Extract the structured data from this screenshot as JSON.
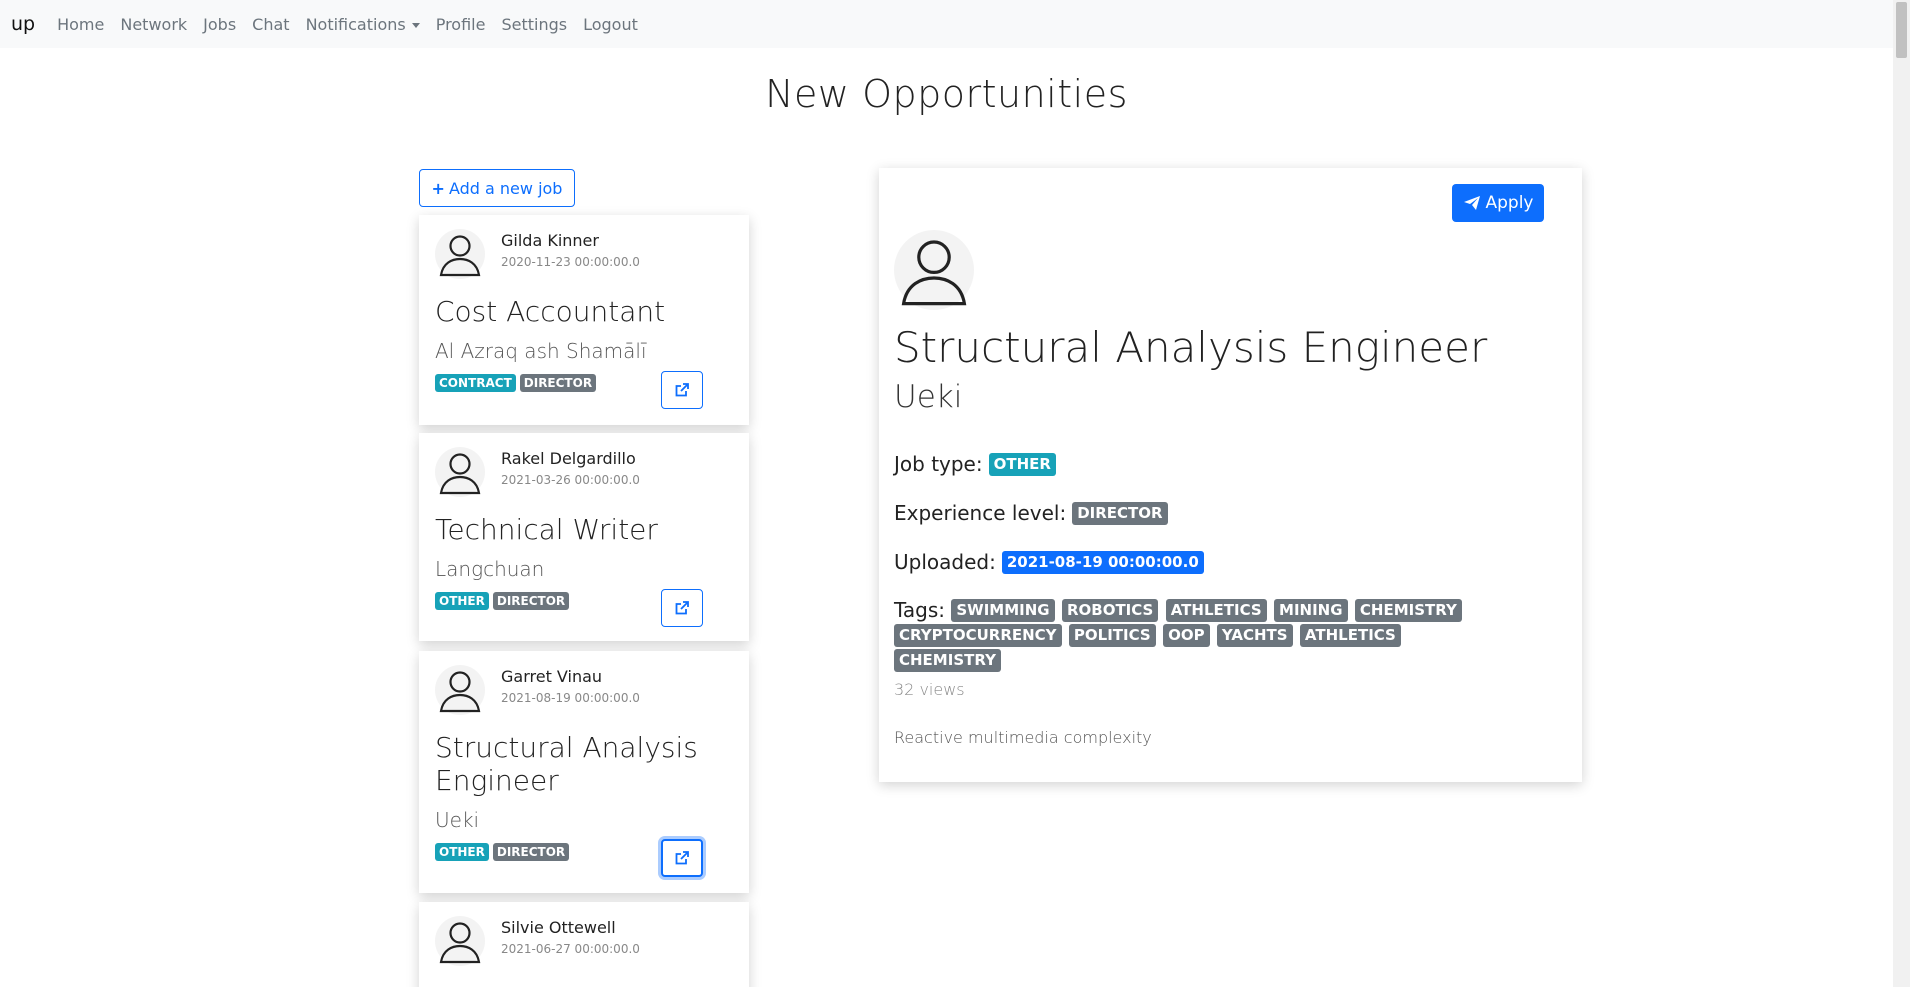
{
  "nav": {
    "brand": "up",
    "items": [
      "Home",
      "Network",
      "Jobs",
      "Chat",
      "Notifications",
      "Profile",
      "Settings",
      "Logout"
    ]
  },
  "page": {
    "title": "New Opportunities",
    "add_job_label": "Add a new job"
  },
  "jobs": [
    {
      "author": "Gilda Kinner",
      "date": "2020-11-23 00:00:00.0",
      "title": "Cost Accountant",
      "location": "Al Azraq ash Shamālī",
      "type": "CONTRACT",
      "level": "DIRECTOR"
    },
    {
      "author": "Rakel Delgardillo",
      "date": "2021-03-26 00:00:00.0",
      "title": "Technical Writer",
      "location": "Langchuan",
      "type": "OTHER",
      "level": "DIRECTOR"
    },
    {
      "author": "Garret Vinau",
      "date": "2021-08-19 00:00:00.0",
      "title": "Structural Analysis Engineer",
      "location": "Ueki",
      "type": "OTHER",
      "level": "DIRECTOR"
    },
    {
      "author": "Silvie Ottewell",
      "date": "2021-06-27 00:00:00.0"
    }
  ],
  "detail": {
    "apply_label": "Apply",
    "title": "Structural Analysis Engineer",
    "location": "Ueki",
    "job_type_label": "Job type:",
    "job_type": "OTHER",
    "experience_label": "Experience level:",
    "experience": "DIRECTOR",
    "uploaded_label": "Uploaded:",
    "uploaded": "2021-08-19 00:00:00.0",
    "tags_label": "Tags:",
    "tags": [
      "SWIMMING",
      "ROBOTICS",
      "ATHLETICS",
      "MINING",
      "CHEMISTRY",
      "CRYPTOCURRENCY",
      "POLITICS",
      "OOP",
      "YACHTS",
      "ATHLETICS",
      "CHEMISTRY"
    ],
    "views": "32 views",
    "description": "Reactive multimedia complexity"
  },
  "colors": {
    "primary": "#0d6efd",
    "info": "#17a2b8",
    "secondary": "#6c757d"
  }
}
